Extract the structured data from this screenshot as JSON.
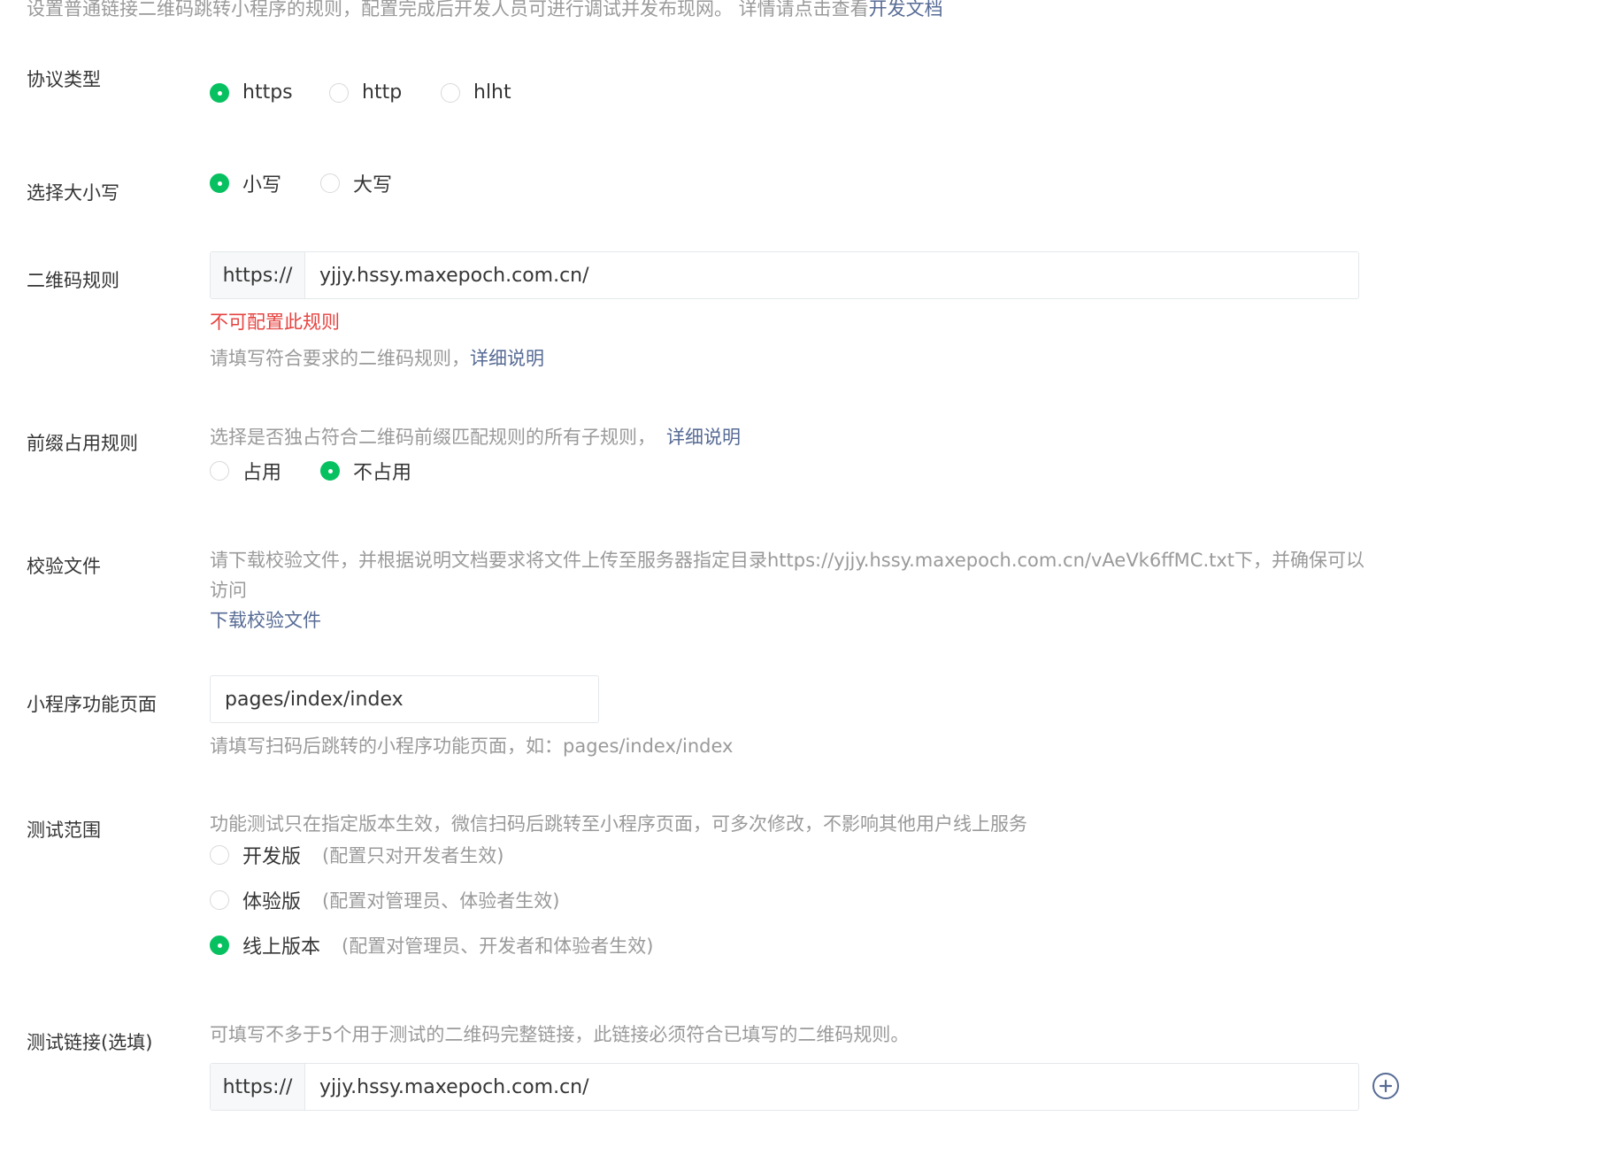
{
  "intro": {
    "text": "设置普通链接二维码跳转小程序的规则，配置完成后开发人员可进行调试并发布现网。 详情请点击查看",
    "link": "开发文档"
  },
  "protocol": {
    "label": "协议类型",
    "options": [
      "https",
      "http",
      "hlht"
    ],
    "selected": "https"
  },
  "case": {
    "label": "选择大小写",
    "options": [
      "小写",
      "大写"
    ],
    "selected": "小写"
  },
  "qr_rule": {
    "label": "二维码规则",
    "prefix": "https://",
    "value": "yjjy.hssy.maxepoch.com.cn/",
    "error": "不可配置此规则",
    "hint": "请填写符合要求的二维码规则，",
    "hint_link": "详细说明"
  },
  "prefix_rule": {
    "label": "前缀占用规则",
    "hint": "选择是否独占符合二维码前缀匹配规则的所有子规则，",
    "hint_link": "详细说明",
    "options": [
      "占用",
      "不占用"
    ],
    "selected": "不占用"
  },
  "verify_file": {
    "label": "校验文件",
    "desc_line1": "请下载校验文件，并根据说明文档要求将文件上传至服务器指定目录https://yjjy.hssy.maxepoch.com.cn/vAeVk6ffMC.txt下，并确保可以",
    "desc_line2": "访问",
    "download_link": "下载校验文件"
  },
  "page_path": {
    "label": "小程序功能页面",
    "value": "pages/index/index",
    "hint": "请填写扫码后跳转的小程序功能页面，如：pages/index/index"
  },
  "test_scope": {
    "label": "测试范围",
    "hint": "功能测试只在指定版本生效，微信扫码后跳转至小程序页面，可多次修改，不影响其他用户线上服务",
    "options": [
      {
        "name": "开发版",
        "desc": "(配置只对开发者生效)"
      },
      {
        "name": "体验版",
        "desc": "(配置对管理员、体验者生效)"
      },
      {
        "name": "线上版本",
        "desc": "(配置对管理员、开发者和体验者生效)"
      }
    ],
    "selected": "线上版本"
  },
  "test_link": {
    "label": "测试链接(选填)",
    "hint": "可填写不多于5个用于测试的二维码完整链接，此链接必须符合已填写的二维码规则。",
    "prefix": "https://",
    "value": "yjjy.hssy.maxepoch.com.cn/",
    "add_icon": "plus-circle-icon"
  },
  "colors": {
    "accent": "#07c160",
    "link": "#576b95",
    "error": "#e64340",
    "hint": "#9a9a9a"
  }
}
